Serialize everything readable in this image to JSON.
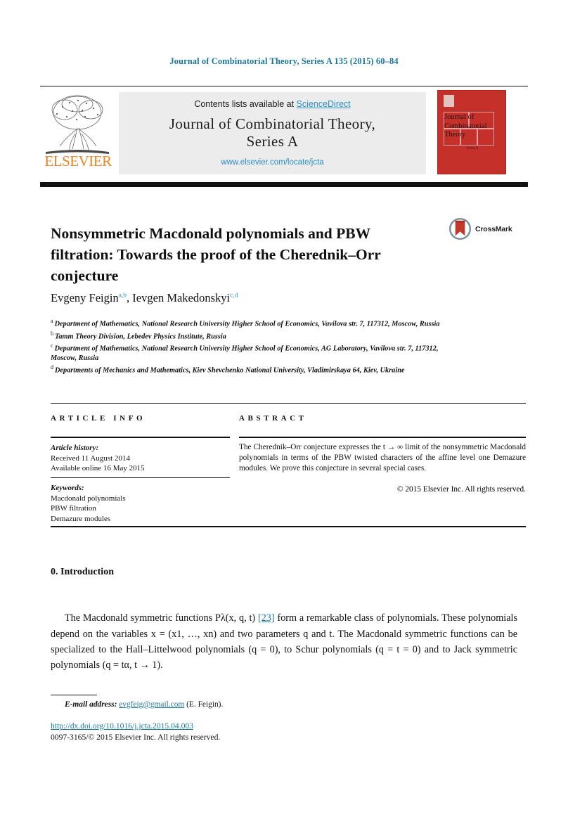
{
  "running_head": "Journal of Combinatorial Theory, Series A 135 (2015) 60–84",
  "masthead": {
    "contents_prefix": "Contents lists available at ",
    "sciencedirect": "ScienceDirect",
    "journal_title_line1": "Journal of Combinatorial Theory,",
    "journal_title_line2": "Series A",
    "journal_url": "www.elsevier.com/locate/jcta",
    "publisher": "ELSEVIER",
    "cover_title": "Journal of Combinatorial Theory",
    "cover_subtitle": "Series A",
    "link_color": "#2b8fc4",
    "cover_color": "#c5302a",
    "elsevier_orange": "#ec8424"
  },
  "article": {
    "title": "Nonsymmetric Macdonald polynomials and PBW filtration: Towards the proof of the Cherednik–Orr conjecture",
    "crossmark_label": "CrossMark",
    "authors": [
      {
        "name": "Evgeny Feigin",
        "marks": "a,b"
      },
      {
        "name": "Ievgen Makedonskyi",
        "marks": "c,d"
      }
    ],
    "authors_separator": ", ",
    "affiliations": [
      {
        "mark": "a",
        "text": "Department of Mathematics, National Research University Higher School of Economics, Vavilova str. 7, 117312, Moscow, Russia"
      },
      {
        "mark": "b",
        "text": "Tamm Theory Division, Lebedev Physics Institute, Russia"
      },
      {
        "mark": "c",
        "text": "Department of Mathematics, National Research University Higher School of Economics, AG Laboratory, Vavilova str. 7, 117312, Moscow, Russia"
      },
      {
        "mark": "d",
        "text": "Departments of Mechanics and Mathematics, Kiev Shevchenko National University, Vladimirskaya 64, Kiev, Ukraine"
      }
    ]
  },
  "info": {
    "heading": "ARTICLE INFO",
    "history_label": "Article history:",
    "received": "Received 11 August 2014",
    "available": "Available online 16 May 2015",
    "keywords_label": "Keywords:",
    "keywords": [
      "Macdonald polynomials",
      "PBW filtration",
      "Demazure modules"
    ]
  },
  "abstract": {
    "heading": "ABSTRACT",
    "text": "The Cherednik–Orr conjecture expresses the t → ∞ limit of the nonsymmetric Macdonald polynomials in terms of the PBW twisted characters of the affine level one Demazure modules. We prove this conjecture in several special cases.",
    "copyright": "© 2015 Elsevier Inc. All rights reserved."
  },
  "body": {
    "section_number": "0.",
    "section_title": "Introduction",
    "paragraph_pre_ref": "The Macdonald symmetric functions Pλ(x, q, t) ",
    "paragraph_ref": "[23]",
    "paragraph_post_ref": " form a remarkable class of polynomials. These polynomials depend on the variables x = (x1, …, xn) and two parameters q and t. The Macdonald symmetric functions can be specialized to the Hall–Littelwood polynomials (q = 0), to Schur polynomials (q = t = 0) and to Jack symmetric polynomials (q = tα, t → 1)."
  },
  "footer": {
    "email_label": "E-mail address:",
    "email": "evgfeig@gmail.com",
    "email_owner": "(E. Feigin).",
    "doi": "http://dx.doi.org/10.1016/j.jcta.2015.04.003",
    "issn_line": "0097-3165/© 2015 Elsevier Inc. All rights reserved."
  }
}
